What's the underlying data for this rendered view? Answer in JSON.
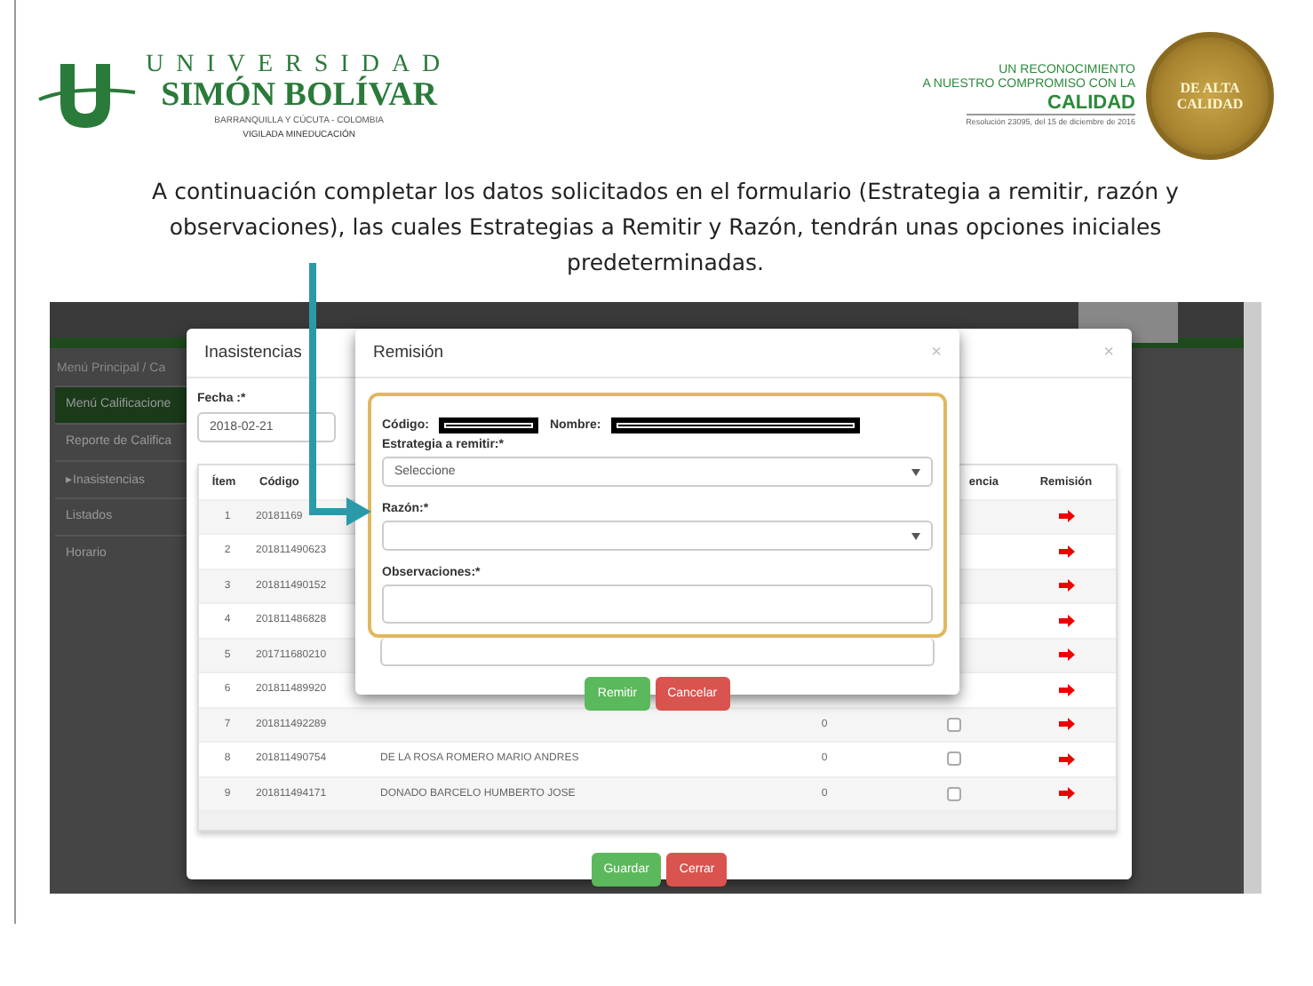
{
  "header": {
    "logo": {
      "line1": "UNIVERSIDAD",
      "line2": "SIMÓN BOLÍVAR",
      "line3": "BARRANQUILLA Y CÚCUTA - COLOMBIA",
      "line4": "VIGILADA MINEDUCACIÓN"
    },
    "quality": {
      "line1": "UN RECONOCIMIENTO",
      "line2": "A NUESTRO COMPROMISO CON LA",
      "line3": "CALIDAD",
      "line4": "Resolución 23095, del 15 de diciembre de 2016",
      "seal_top": "DE ALTA",
      "seal_bottom": "CALIDAD"
    }
  },
  "instruction": "A continuación completar los datos solicitados en el formulario (Estrategia a remitir, razón y observaciones), las cuales Estrategias a Remitir y Razón, tendrán unas opciones iniciales predeterminadas.",
  "app": {
    "breadcrumb": "Menú Principal / Ca",
    "sidebar": [
      {
        "label": "Menú Calificacione",
        "selected": true
      },
      {
        "label": "Reporte de Califica",
        "selected": false
      },
      {
        "label": "▸Inasistencias",
        "selected": false
      },
      {
        "label": "Listados",
        "selected": false
      },
      {
        "label": "Horario",
        "selected": false
      }
    ],
    "inasistencias": {
      "title": "Inasistencias",
      "close": "×",
      "date_label": "Fecha :*",
      "date_value": "2018-02-21",
      "columns": [
        "Ítem",
        "Código",
        "encia",
        "Remisión"
      ],
      "rows": [
        {
          "item": "1",
          "code": "20181169"
        },
        {
          "item": "2",
          "code": "201811490623"
        },
        {
          "item": "3",
          "code": "201811490152"
        },
        {
          "item": "4",
          "code": "201811486828"
        },
        {
          "item": "5",
          "code": "201711680210"
        },
        {
          "item": "6",
          "code": "201811489920"
        },
        {
          "item": "7",
          "code": "201811492289",
          "count": "0",
          "checked": false
        },
        {
          "item": "8",
          "code": "201811490754",
          "name": "DE LA ROSA ROMERO MARIO ANDRES",
          "count": "0",
          "checked": false
        },
        {
          "item": "9",
          "code": "201811494171",
          "name": "DONADO BARCELO HUMBERTO JOSE",
          "count": "0",
          "checked": false
        }
      ],
      "buttons": [
        {
          "label": "Guardar",
          "kind": "success"
        },
        {
          "label": "Cerrar",
          "kind": "danger"
        }
      ]
    },
    "remision": {
      "title": "Remisión",
      "close": "×",
      "code_label": "Código:",
      "name_label": "Nombre:",
      "strategy_label": "Estrategia a remitir:*",
      "strategy_value": "Seleccione",
      "reason_label": "Razón:*",
      "observations_label": "Observaciones:*",
      "buttons": [
        {
          "label": "Remitir",
          "kind": "success"
        },
        {
          "label": "Cancelar",
          "kind": "danger"
        }
      ]
    }
  }
}
